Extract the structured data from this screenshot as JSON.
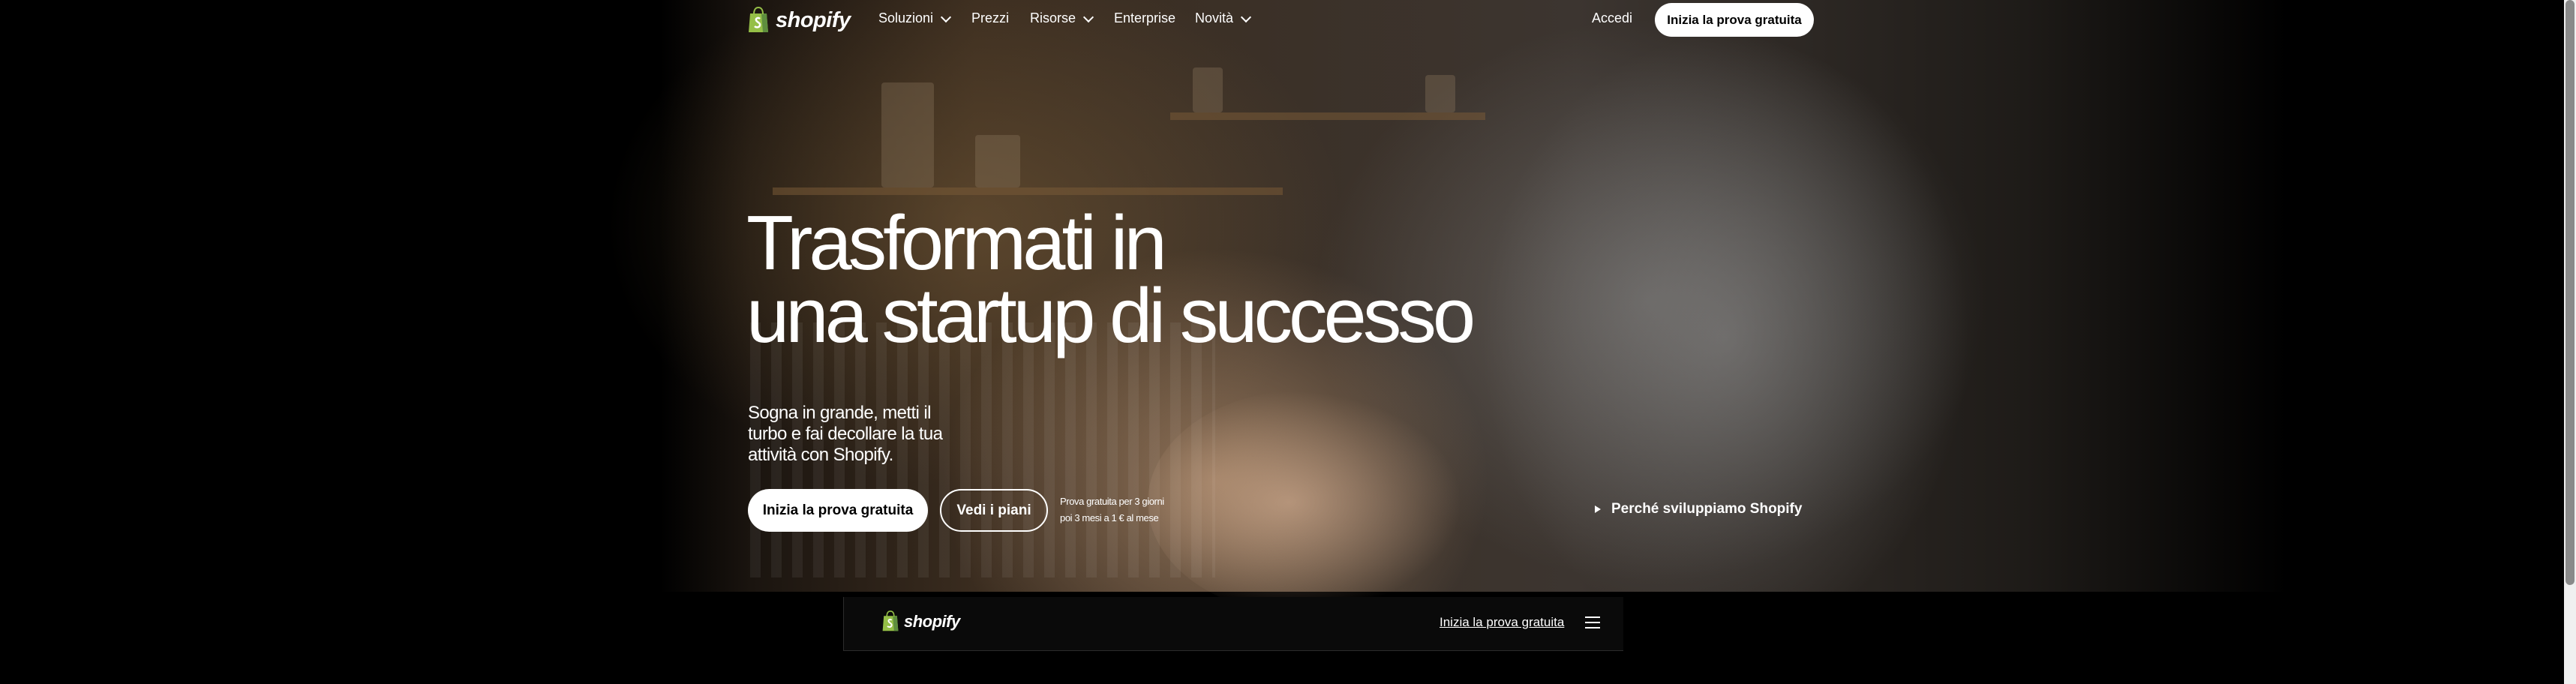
{
  "nav": {
    "logo_text": "shopify",
    "items": [
      {
        "label": "Soluzioni",
        "has_dropdown": true
      },
      {
        "label": "Prezzi",
        "has_dropdown": false
      },
      {
        "label": "Risorse",
        "has_dropdown": true
      },
      {
        "label": "Enterprise",
        "has_dropdown": false
      },
      {
        "label": "Novità",
        "has_dropdown": true
      }
    ],
    "login_label": "Accedi",
    "cta_label": "Inizia la prova gratuita"
  },
  "hero": {
    "headline_line1": "Trasformati in",
    "headline_line2": "una startup di successo",
    "subtitle": "Sogna in grande, metti il turbo e fai decollare la tua attività con Shopify.",
    "primary_cta": "Inizia la prova gratuita",
    "secondary_cta": "Vedi i piani",
    "trial_line1": "Prova gratuita per 3 giorni",
    "trial_line2": "poi 3 mesi a 1 € al mese",
    "video_link": "Perché sviluppiamo Shopify"
  },
  "sticky_bar": {
    "logo_text": "shopify",
    "cta_link": "Inizia la prova gratuita"
  },
  "icons": {
    "logo": "shopify-bag-icon",
    "dropdown": "chevron-down-icon",
    "play": "play-icon",
    "menu": "hamburger-menu-icon"
  },
  "colors": {
    "background": "#000000",
    "text": "#ffffff",
    "logo_green": "#95bf47",
    "logo_dark_green": "#5e8e3e"
  }
}
